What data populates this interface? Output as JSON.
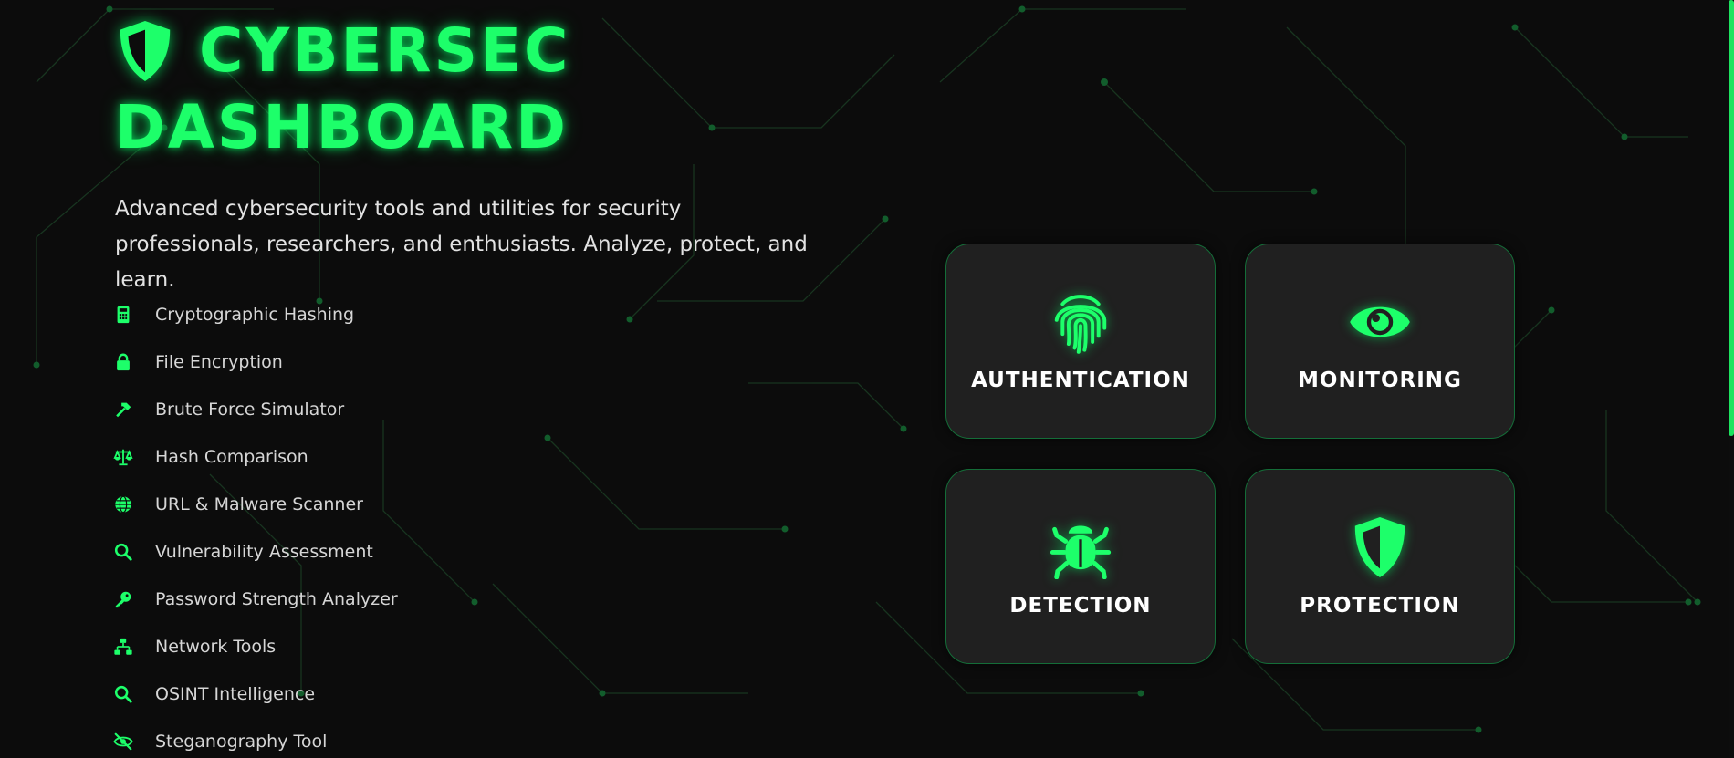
{
  "hero": {
    "title_line1": "CYBERSEC",
    "title_line2": "DASHBOARD",
    "subtitle": "Advanced cybersecurity tools and utilities for security professionals, researchers, and enthusiasts. Analyze, protect, and learn.",
    "title_icon": "shield-icon"
  },
  "features": [
    {
      "label": "Cryptographic Hashing",
      "icon": "calculator-icon"
    },
    {
      "label": "File Encryption",
      "icon": "lock-icon"
    },
    {
      "label": "Brute Force Simulator",
      "icon": "hammer-icon"
    },
    {
      "label": "Hash Comparison",
      "icon": "balance-scale-icon"
    },
    {
      "label": "URL & Malware Scanner",
      "icon": "globe-icon"
    },
    {
      "label": "Vulnerability Assessment",
      "icon": "search-icon"
    },
    {
      "label": "Password Strength Analyzer",
      "icon": "key-icon"
    },
    {
      "label": "Network Tools",
      "icon": "network-icon"
    },
    {
      "label": "OSINT Intelligence",
      "icon": "search-icon"
    },
    {
      "label": "Steganography Tool",
      "icon": "eye-slash-icon"
    }
  ],
  "cards": [
    {
      "label": "AUTHENTICATION",
      "icon": "fingerprint-icon"
    },
    {
      "label": "MONITORING",
      "icon": "eye-icon"
    },
    {
      "label": "DETECTION",
      "icon": "bug-icon"
    },
    {
      "label": "PROTECTION",
      "icon": "shield-icon"
    }
  ],
  "colors": {
    "accent": "#1dff6a",
    "background": "#0c0c0c",
    "card": "#202020",
    "text": "#e2e2e2"
  }
}
